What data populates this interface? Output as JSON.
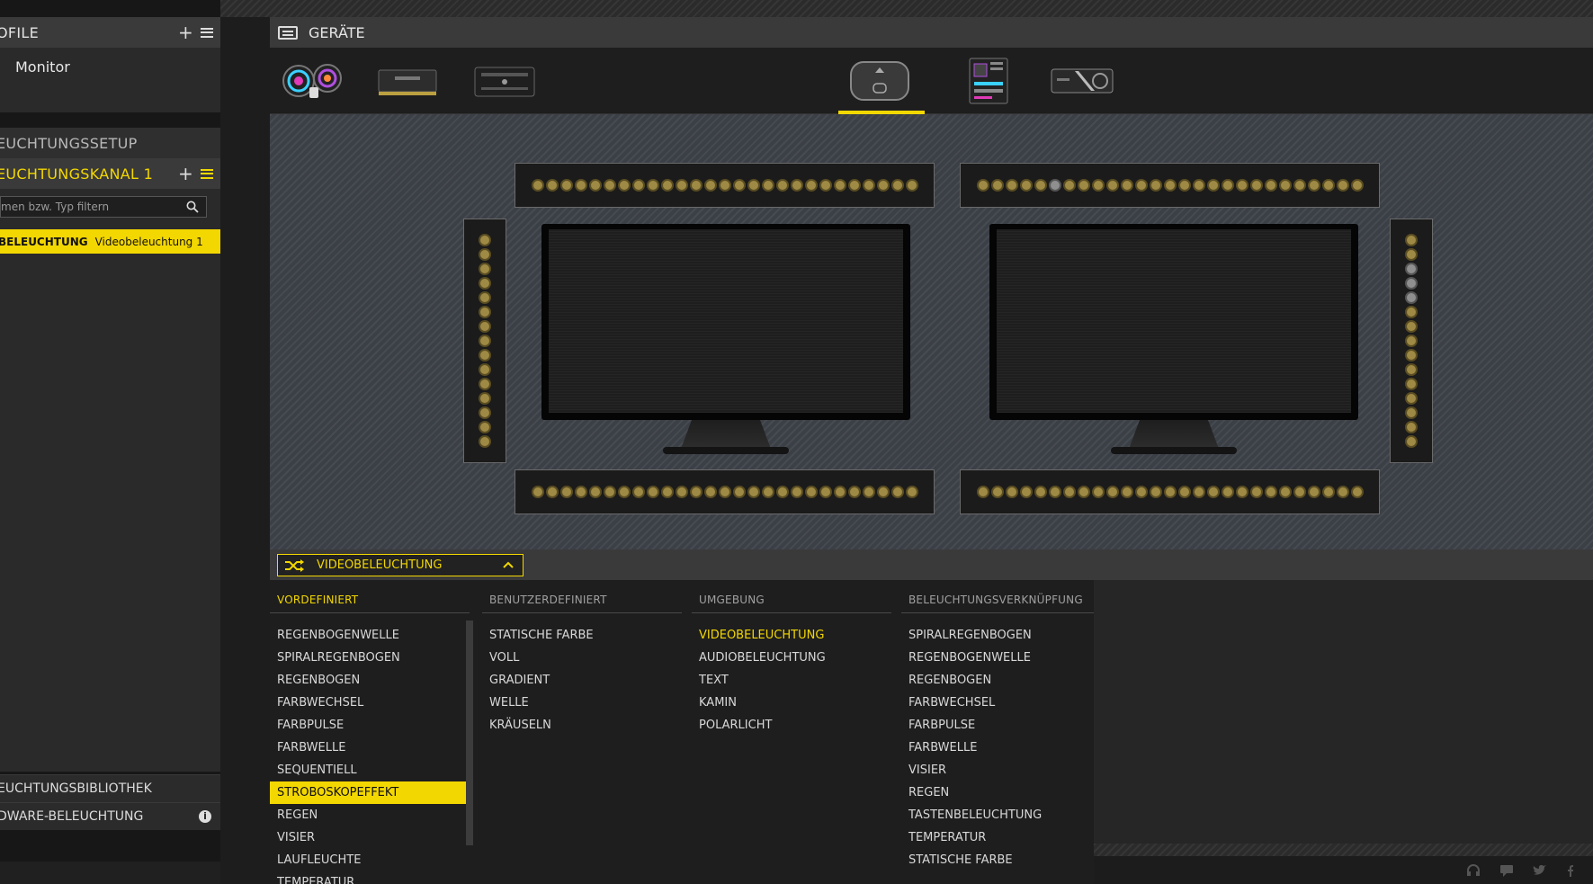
{
  "colors": {
    "accent": "#f3d700",
    "panel_header": "#3a3a3a",
    "led": "#9e8a44"
  },
  "profiles": {
    "header": "OFILE",
    "item": "Monitor"
  },
  "lighting_setup": {
    "header": "EUCHTUNGSSETUP",
    "channel_header": "EUCHTUNGSKANAL 1",
    "filter_placeholder": "men bzw. Typ filtern",
    "channel_row": {
      "type": "BELEUCHTUNG",
      "name": "Videobeleuchtung 1"
    }
  },
  "library": {
    "label": "EUCHTUNGSBIBLIOTHEK"
  },
  "hardware": {
    "label": "DWARE-BELEUCHTUNG"
  },
  "tools": [
    "copy-icon",
    "paste-icon",
    "move-icon",
    "delete-icon"
  ],
  "devices": {
    "header": "GERÄTE",
    "items": [
      {
        "name": "aio-cooler",
        "icon": "cooler-icon"
      },
      {
        "name": "memory",
        "icon": "ram-icon"
      },
      {
        "name": "controller",
        "icon": "controller-icon"
      },
      {
        "name": "monitor-hub",
        "icon": "hub-icon",
        "selected": true
      },
      {
        "name": "motherboard",
        "icon": "motherboard-icon"
      },
      {
        "name": "graphics-card",
        "icon": "gpu-icon"
      }
    ]
  },
  "effect_selector": {
    "label": "VIDEOBELEUCHTUNG"
  },
  "effects": {
    "columns": [
      {
        "header": "VORDEFINIERT",
        "active": true,
        "items": [
          "REGENBOGENWELLE",
          "SPIRALREGENBOGEN",
          "REGENBOGEN",
          "FARBWECHSEL",
          "FARBPULSE",
          "FARBWELLE",
          "SEQUENTIELL",
          "STROBOSKOPEFFEKT",
          "REGEN",
          "VISIER",
          "LAUFLEUCHTE",
          "TEMPERATUR"
        ],
        "selected": "STROBOSKOPEFFEKT"
      },
      {
        "header": "BENUTZERDEFINIERT",
        "items": [
          "STATISCHE FARBE",
          "VOLL",
          "GRADIENT",
          "WELLE",
          "KRÄUSELN"
        ]
      },
      {
        "header": "UMGEBUNG",
        "items": [
          "VIDEOBELEUCHTUNG",
          "AUDIOBELEUCHTUNG",
          "TEXT",
          "KAMIN",
          "POLARLICHT"
        ],
        "highlight": "VIDEOBELEUCHTUNG"
      },
      {
        "header": "BELEUCHTUNGSVERKNÜPFUNG",
        "items": [
          "SPIRALREGENBOGEN",
          "REGENBOGENWELLE",
          "REGENBOGEN",
          "FARBWECHSEL",
          "FARBPULSE",
          "FARBWELLE",
          "VISIER",
          "REGEN",
          "TASTENBELEUCHTUNG",
          "TEMPERATUR",
          "STATISCHE FARBE"
        ]
      }
    ]
  },
  "status_icons": [
    "headset-icon",
    "chat-icon",
    "twitter-icon",
    "facebook-icon"
  ]
}
